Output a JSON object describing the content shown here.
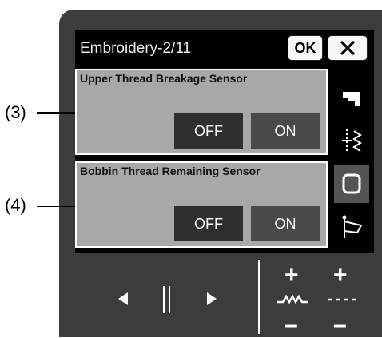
{
  "header": {
    "title": "Embroidery-2/11",
    "ok_label": "OK"
  },
  "panels": [
    {
      "label": "Upper Thread Breakage Sensor",
      "off": "OFF",
      "on": "ON"
    },
    {
      "label": "Bobbin Thread Remaining Sensor",
      "off": "OFF",
      "on": "ON"
    }
  ],
  "callouts": [
    "(3)",
    "(4)"
  ],
  "sidebar": {
    "items": [
      "sewing-machine-icon",
      "embroidery-icon",
      "bobbin-icon",
      "flag-icon"
    ],
    "active": 2
  },
  "controls": {
    "plus": "+",
    "minus": "–"
  },
  "colors": {
    "panel": "#a8a8a8",
    "off_button": "#2f2f2f",
    "on_button": "#4a4a4a",
    "bezel": "#3c3c3c"
  }
}
